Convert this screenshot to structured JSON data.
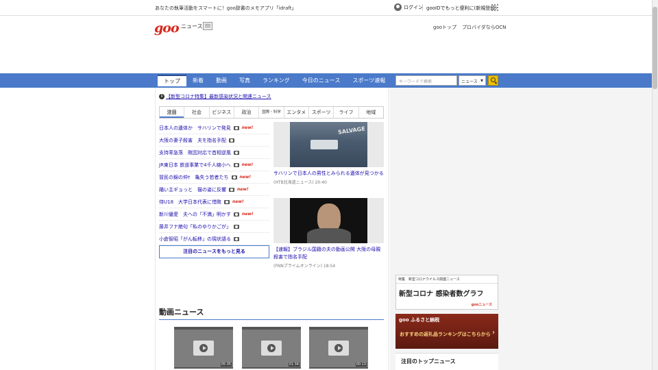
{
  "topbar": {
    "promo_text": "あなたの執筆活動をスマートに！goo辞書のメモアプリ「idraft」",
    "login_label": "ログイン",
    "register_text": "gooIDでもっと便利に(新規登録)"
  },
  "header": {
    "logo": "goo",
    "logo_sub": "ニュース",
    "link_goo_top": "gooトップ",
    "link_provider": "プロバイダならOCN"
  },
  "nav": {
    "tabs": [
      {
        "label": "トップ"
      },
      {
        "label": "新着"
      },
      {
        "label": "動画"
      },
      {
        "label": "写真"
      },
      {
        "label": "ランキング"
      },
      {
        "label": "今日のニュース"
      },
      {
        "label": "スポーツ速報"
      }
    ],
    "search_placeholder": "キーワードで検索",
    "search_scope": "ニュース"
  },
  "main": {
    "corona_link": "【新型コロナ特集】最新感染状況と関連ニュース",
    "category_tabs": [
      {
        "label": "注目"
      },
      {
        "label": "社会"
      },
      {
        "label": "ビジネス"
      },
      {
        "label": "政治"
      },
      {
        "label": "国際・科学"
      },
      {
        "label": "エンタメ"
      },
      {
        "label": "スポーツ"
      },
      {
        "label": "ライフ"
      },
      {
        "label": "地域"
      }
    ],
    "headlines": [
      {
        "text": "日本人の遺体か　サハリンで発見",
        "new": "new!"
      },
      {
        "text": "大阪の妻子殺害　夫を指名手配",
        "new": ""
      },
      {
        "text": "支持率急落　敗因対応で首相逆風",
        "new": ""
      },
      {
        "text": "JR東日本 鉄道事業で4千人縮小へ",
        "new": "new!"
      },
      {
        "text": "冒民の錦の仲†　亀失う若者たち",
        "new": "new!"
      },
      {
        "text": "踊い主ギョっと　猫の姿に反響",
        "new": "new!"
      },
      {
        "text": "侍U18　大学日本代表に惜敗",
        "new": "new!"
      },
      {
        "text": "新川優愛　夫への「不満」明かす",
        "new": "new!"
      },
      {
        "text": "藤井フナ絶句「私のゆりかごが」",
        "new": ""
      },
      {
        "text": "小倉智昭「がん転移」の現状語る",
        "new": ""
      }
    ],
    "more_button": "注目のニュースをもっと見る",
    "features": [
      {
        "title": "サハリンで日本人の男性とみられる遺体が見つかる",
        "source": "(HTB北海道ニュース) 20:40"
      },
      {
        "title": "【速報】ブラジル国籍の夫の動画公開 大阪の母親殺害で指名手配",
        "source": "(FNNプライムオンライン) 18:54"
      }
    ],
    "video_section_title": "動画ニュース",
    "videos": [
      {
        "duration": "05:35"
      },
      {
        "duration": "01:34"
      },
      {
        "duration": "00:13"
      }
    ]
  },
  "sidebar": {
    "covid_banner_top": "特集　新型コロナウイルス関連ニュース",
    "covid_banner_main": "新型コロナ 感染者数グラフ",
    "covid_banner_brand": "gooニュース",
    "furusato_top": "goo ふるさと納税",
    "furusato_main": "おすすめの返礼品ランキングはこちらから",
    "top_news_heading": "注目のトップニュース"
  },
  "colors": {
    "nav_blue": "#4a7ac9",
    "logo_red": "#d6281d",
    "link_blue": "#1a0dab",
    "new_red": "#d6281d"
  }
}
